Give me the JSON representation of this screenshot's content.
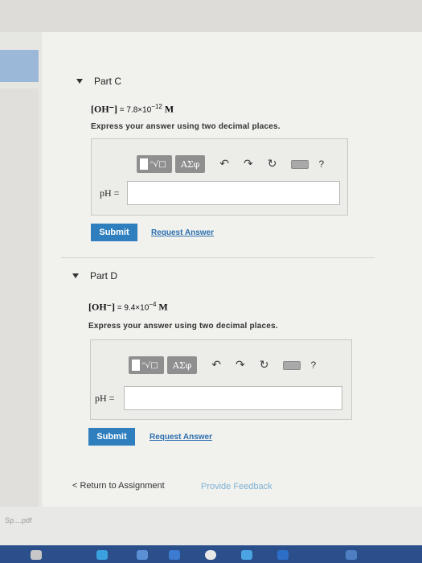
{
  "partC": {
    "title": "Part C",
    "formula_species": "[OH⁻]",
    "formula_eq": " = 7.8×10",
    "formula_exp": "−12",
    "formula_unit": " M",
    "instruction": "Express your answer using two decimal places.",
    "toolbar": {
      "frac_icon": "ⁿ√□",
      "symbols": "ΑΣφ",
      "help": "?"
    },
    "input_label": "pH =",
    "input_value": "",
    "submit_label": "Submit",
    "request_label": "Request Answer"
  },
  "partD": {
    "title": "Part D",
    "formula_species": "[OH⁻]",
    "formula_eq": " = 9.4×10",
    "formula_exp": "−4",
    "formula_unit": " M",
    "instruction": "Express your answer using two decimal places.",
    "toolbar": {
      "frac_icon": "ⁿ√□",
      "symbols": "ΑΣφ",
      "help": "?"
    },
    "input_label": "pH =",
    "input_value": "",
    "submit_label": "Submit",
    "request_label": "Request Answer"
  },
  "footer": {
    "return_label": "< Return to Assignment",
    "feedback_label": "Provide Feedback"
  },
  "download": {
    "file_label": "Sp....pdf"
  },
  "colors": {
    "submit": "#2f7fbf",
    "link": "#2c6fae",
    "feedback": "#7fb3d6"
  }
}
